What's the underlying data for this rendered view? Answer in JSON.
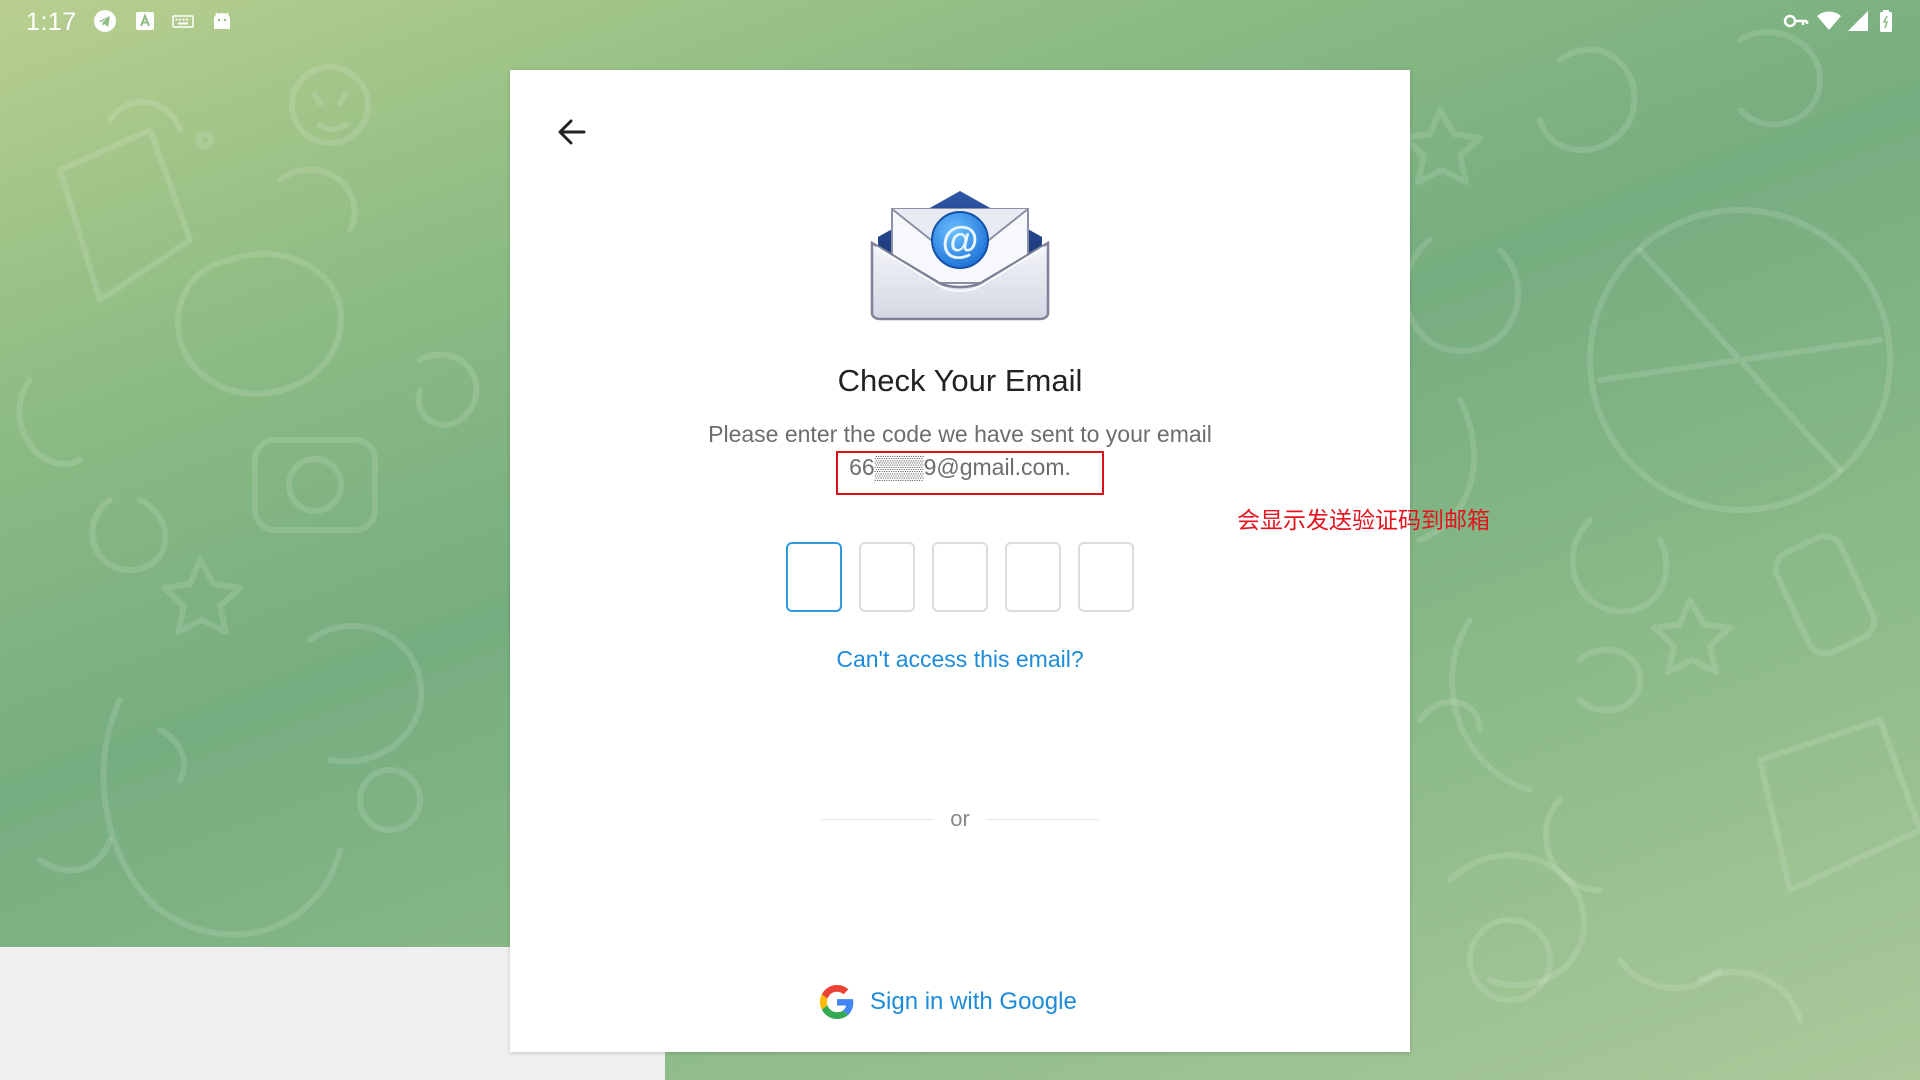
{
  "status_bar": {
    "time": "1:17",
    "left_icons": [
      "telegram-icon",
      "text-icon",
      "keyboard-icon",
      "android-icon"
    ],
    "right_icons": [
      "vpn-key-icon",
      "wifi-icon",
      "signal-icon",
      "battery-icon"
    ]
  },
  "dialog": {
    "back_icon": "arrow-left-icon",
    "illustration": "email-envelope-icon",
    "title": "Check Your Email",
    "description": "Please enter the code we have sent to your email",
    "email": "66▒▒▒9@gmail.com.",
    "code_length": 5,
    "active_code_index": 0,
    "alt_link": "Can't access this email?",
    "divider_text": "or",
    "google_button_label": "Sign in with Google"
  },
  "annotation": {
    "text": "会显示发送验证码到邮箱",
    "color": "#e3141d"
  },
  "colors": {
    "accent": "#1c8bd9",
    "active_border": "#2f9ae0",
    "background_green": "#76ad80"
  }
}
